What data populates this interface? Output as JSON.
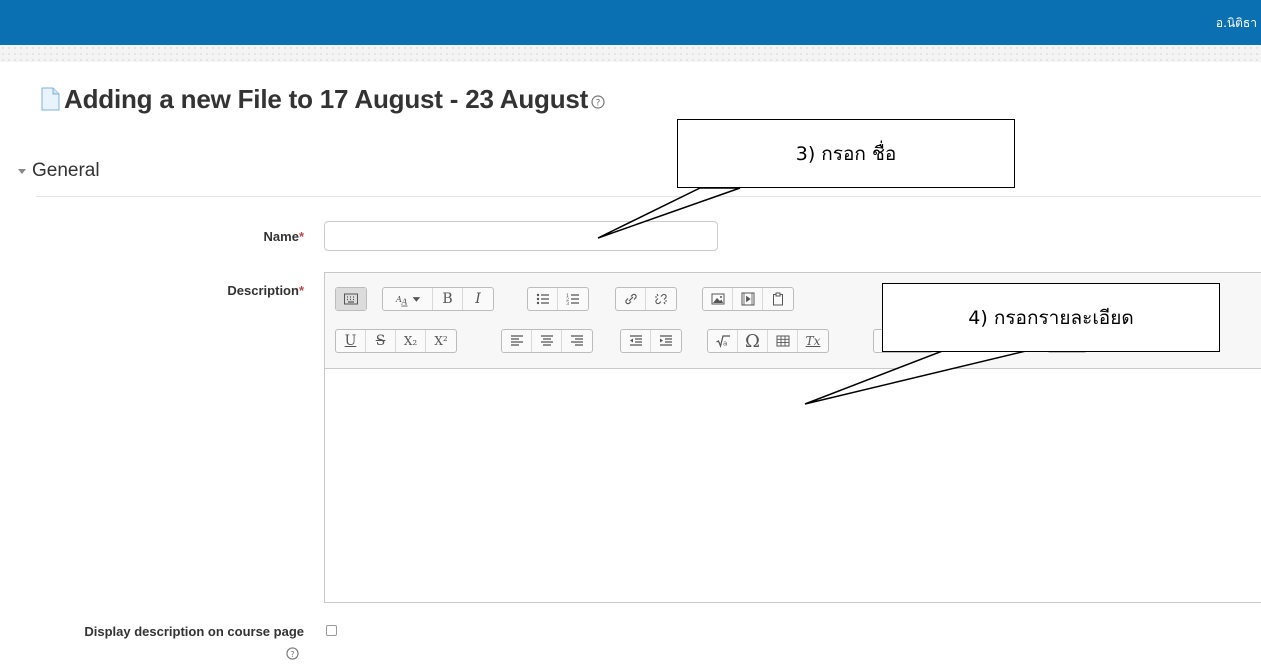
{
  "header": {
    "user_name": "อ.นิติธา"
  },
  "page": {
    "title": "Adding a new File to 17 August - 23 August"
  },
  "section": {
    "title": "General"
  },
  "form": {
    "name_label": "Name",
    "name_value": "",
    "required_marker": "*",
    "description_label": "Description",
    "display_desc_label": "Display description on course page",
    "display_desc_checked": false
  },
  "editor_toolbar": {
    "row1": [
      [
        "show-more-buttons"
      ],
      [
        "font-size",
        "bold",
        "italic"
      ],
      [
        "bullet-list",
        "numbered-list"
      ],
      [
        "link",
        "unlink"
      ],
      [
        "image",
        "media",
        "paste"
      ]
    ],
    "row2": [
      [
        "underline",
        "strikethrough",
        "subscript",
        "superscript"
      ],
      [
        "align-left",
        "align-center",
        "align-right"
      ],
      [
        "outdent",
        "indent"
      ],
      [
        "equation",
        "special-character",
        "table",
        "clear-formatting"
      ]
    ],
    "glyphs": {
      "bold": "B",
      "italic": "I",
      "underline": "U",
      "strikethrough": "S",
      "subscript": "X₂",
      "superscript": "X²",
      "special-character": "Ω",
      "clear-formatting": "Tx"
    }
  },
  "annotations": {
    "callout_name": "3) กรอก ชื่อ",
    "callout_description": "4) กรอกรายละเอียด"
  },
  "colors": {
    "topbar": "#0b70b1",
    "required": "#b94a48"
  }
}
